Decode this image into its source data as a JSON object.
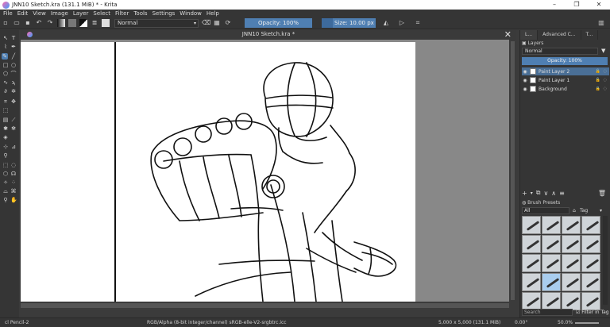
{
  "window": {
    "title": "JNN10 Sketch.kra (131.1 MiB)  * - Krita",
    "controls": {
      "minimize": "–",
      "maximize": "❐",
      "close": "✕"
    }
  },
  "menu": [
    "File",
    "Edit",
    "View",
    "Image",
    "Layer",
    "Select",
    "Filter",
    "Tools",
    "Settings",
    "Window",
    "Help"
  ],
  "toolbar": {
    "blend_mode": "Normal",
    "opacity": "Opacity: 100%",
    "size": "Size: 10.00 px"
  },
  "document": {
    "tab_title": "JNN10 Sketch.kra *",
    "close": "✕"
  },
  "dock": {
    "tabs": [
      "L...",
      "Advanced C...",
      "T..."
    ],
    "layers_title": "Layers",
    "blend_mode": "Normal",
    "opacity": "Opacity:  100%",
    "layers": [
      {
        "name": "Paint Layer 2"
      },
      {
        "name": "Paint Layer 1"
      },
      {
        "name": "Background"
      }
    ],
    "brush_presets_title": "Brush Presets",
    "brush_filter": "All",
    "tag_label": "Tag",
    "search_placeholder": "Search",
    "filter_in_tag": "Filter in Tag"
  },
  "status": {
    "brush": "cl Pencil-2",
    "color_model": "RGB/Alpha (8-bit integer/channel)  sRGB-elle-V2-srgbtrc.icc",
    "dimensions": "5,000 x 5,000 (131.1 MiB)",
    "rotation": "0.00°",
    "zoom": "50.0%"
  },
  "colors": {
    "accent": "#4f7fb2",
    "panel": "#353535",
    "canvas_bg": "#888888",
    "active_layer": "#4a6f96"
  }
}
